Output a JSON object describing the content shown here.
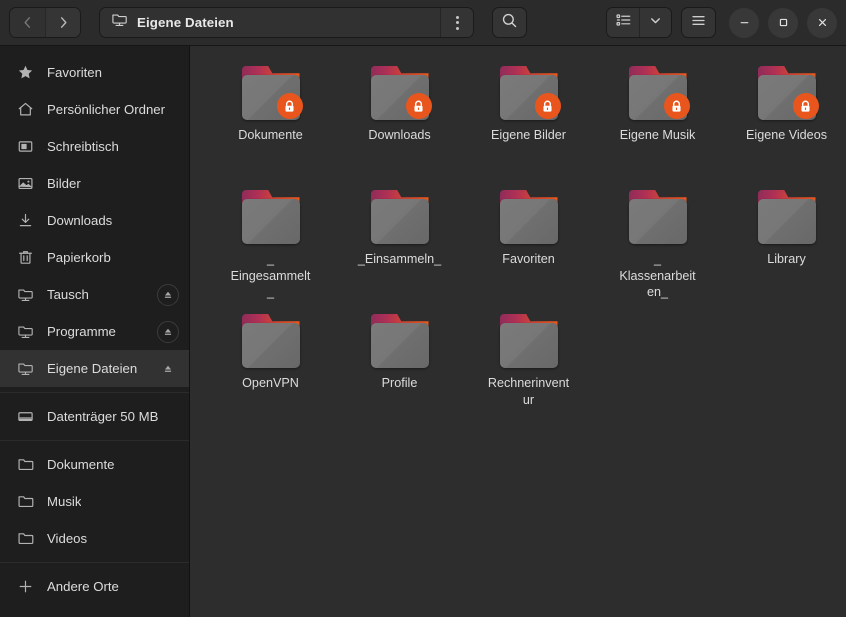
{
  "window": {
    "title": "Eigene Dateien",
    "path_icon": "network-folder-icon"
  },
  "header": {
    "back_label": "Zurück",
    "forward_label": "Vor",
    "menu_dots_label": "Pfadmenü",
    "search_label": "Suchen",
    "view_list_label": "Listenansicht",
    "view_dropdown_label": "Ansichtsoptionen",
    "main_menu_label": "Hauptmenü",
    "minimize_label": "Minimieren",
    "maximize_label": "Maximieren",
    "close_label": "Schließen"
  },
  "sidebar": {
    "groups": [
      {
        "items": [
          {
            "label": "Favoriten",
            "icon": "star-icon",
            "eject": false,
            "selected": false
          },
          {
            "label": "Persönlicher Ordner",
            "icon": "home-icon",
            "eject": false,
            "selected": false
          },
          {
            "label": "Schreibtisch",
            "icon": "desktop-icon",
            "eject": false,
            "selected": false
          },
          {
            "label": "Bilder",
            "icon": "image-icon",
            "eject": false,
            "selected": false
          },
          {
            "label": "Downloads",
            "icon": "download-icon",
            "eject": false,
            "selected": false
          },
          {
            "label": "Papierkorb",
            "icon": "trash-icon",
            "eject": false,
            "selected": false
          },
          {
            "label": "Tausch",
            "icon": "network-folder-icon",
            "eject": true,
            "selected": false
          },
          {
            "label": "Programme",
            "icon": "network-folder-icon",
            "eject": true,
            "selected": false
          },
          {
            "label": "Eigene Dateien",
            "icon": "network-folder-icon",
            "eject": true,
            "selected": true
          }
        ]
      },
      {
        "items": [
          {
            "label": "Datenträger 50 MB",
            "icon": "drive-icon",
            "eject": false,
            "selected": false
          }
        ]
      },
      {
        "items": [
          {
            "label": "Dokumente",
            "icon": "folder-icon",
            "eject": false,
            "selected": false
          },
          {
            "label": "Musik",
            "icon": "folder-icon",
            "eject": false,
            "selected": false
          },
          {
            "label": "Videos",
            "icon": "folder-icon",
            "eject": false,
            "selected": false
          }
        ]
      },
      {
        "items": [
          {
            "label": "Andere Orte",
            "icon": "plus-icon",
            "eject": false,
            "selected": false
          }
        ]
      }
    ]
  },
  "content": {
    "files": [
      {
        "label": "Dokumente",
        "locked": true
      },
      {
        "label": "Downloads",
        "locked": true
      },
      {
        "label": "Eigene Bilder",
        "locked": true
      },
      {
        "label": "Eigene Musik",
        "locked": true
      },
      {
        "label": "Eigene Videos",
        "locked": true
      },
      {
        "label": "_\nEingesammelt\n_",
        "locked": false
      },
      {
        "label": "_Einsammeln_",
        "locked": false
      },
      {
        "label": "Favoriten",
        "locked": false
      },
      {
        "label": "_\nKlassenarbeit\nen_",
        "locked": false
      },
      {
        "label": "Library",
        "locked": false
      },
      {
        "label": "OpenVPN",
        "locked": false
      },
      {
        "label": "Profile",
        "locked": false
      },
      {
        "label": "Rechnerinvent\nur",
        "locked": false
      }
    ]
  },
  "colors": {
    "accent_orange": "#e8561d",
    "folder_tab_magenta": "#a02e58",
    "sidebar_bg": "#1e1e1e",
    "content_bg": "#2d2d2d",
    "header_bg": "#2b2b2b",
    "selected_row": "#323232"
  }
}
